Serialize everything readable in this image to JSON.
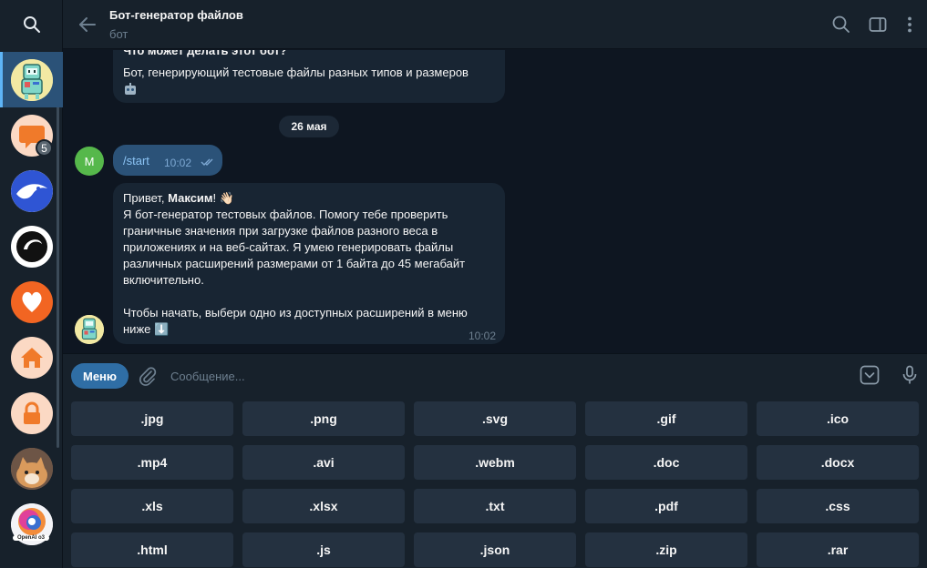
{
  "header": {
    "title": "Бот-генератор файлов",
    "subtitle": "бот"
  },
  "rail": {
    "unread_badge": "5",
    "openai_label": "OpenAI o3"
  },
  "messages": {
    "bot_intro_partial": "Что может делать этот бот?",
    "bot_intro_text": "Бот, генерирующий тестовые файлы разных типов и размеров",
    "date_divider": "26 мая",
    "user_avatar_letter": "М",
    "user_command": "/start",
    "user_time": "10:02",
    "bot_greeting_prefix": "Привет, ",
    "bot_greeting_name": "Максим",
    "bot_greeting_suffix": "! 👋🏻",
    "bot_line1": "Я бот-генератор тестовых файлов. Помогу тебе проверить",
    "bot_line2": "граничные значения при загрузке файлов разного веса в",
    "bot_line3": "приложениях и на веб-сайтах. Я умею генерировать файлы",
    "bot_line4": "различных расширений размерами от 1 байта до 45 мегабайт",
    "bot_line5": "включительно.",
    "bot_line6": "Чтобы начать, выбери одно из доступных расширений в меню",
    "bot_line7": "ниже ⬇️",
    "bot_time": "10:02"
  },
  "composer": {
    "menu_label": "Меню",
    "placeholder": "Сообщение..."
  },
  "keyboard": {
    "rows": [
      [
        ".jpg",
        ".png",
        ".svg",
        ".gif",
        ".ico"
      ],
      [
        ".mp4",
        ".avi",
        ".webm",
        ".doc",
        ".docx"
      ],
      [
        ".xls",
        ".xlsx",
        ".txt",
        ".pdf",
        ".css"
      ],
      [
        ".html",
        ".js",
        ".json",
        ".zip",
        ".rar"
      ]
    ]
  },
  "colors": {
    "background": "#0e1621",
    "panel": "#17212b",
    "bubble_in": "#182533",
    "bubble_out": "#2b5278",
    "accent": "#5eb5f7",
    "menu_button": "#2f6ea5",
    "key_button": "#243140"
  }
}
